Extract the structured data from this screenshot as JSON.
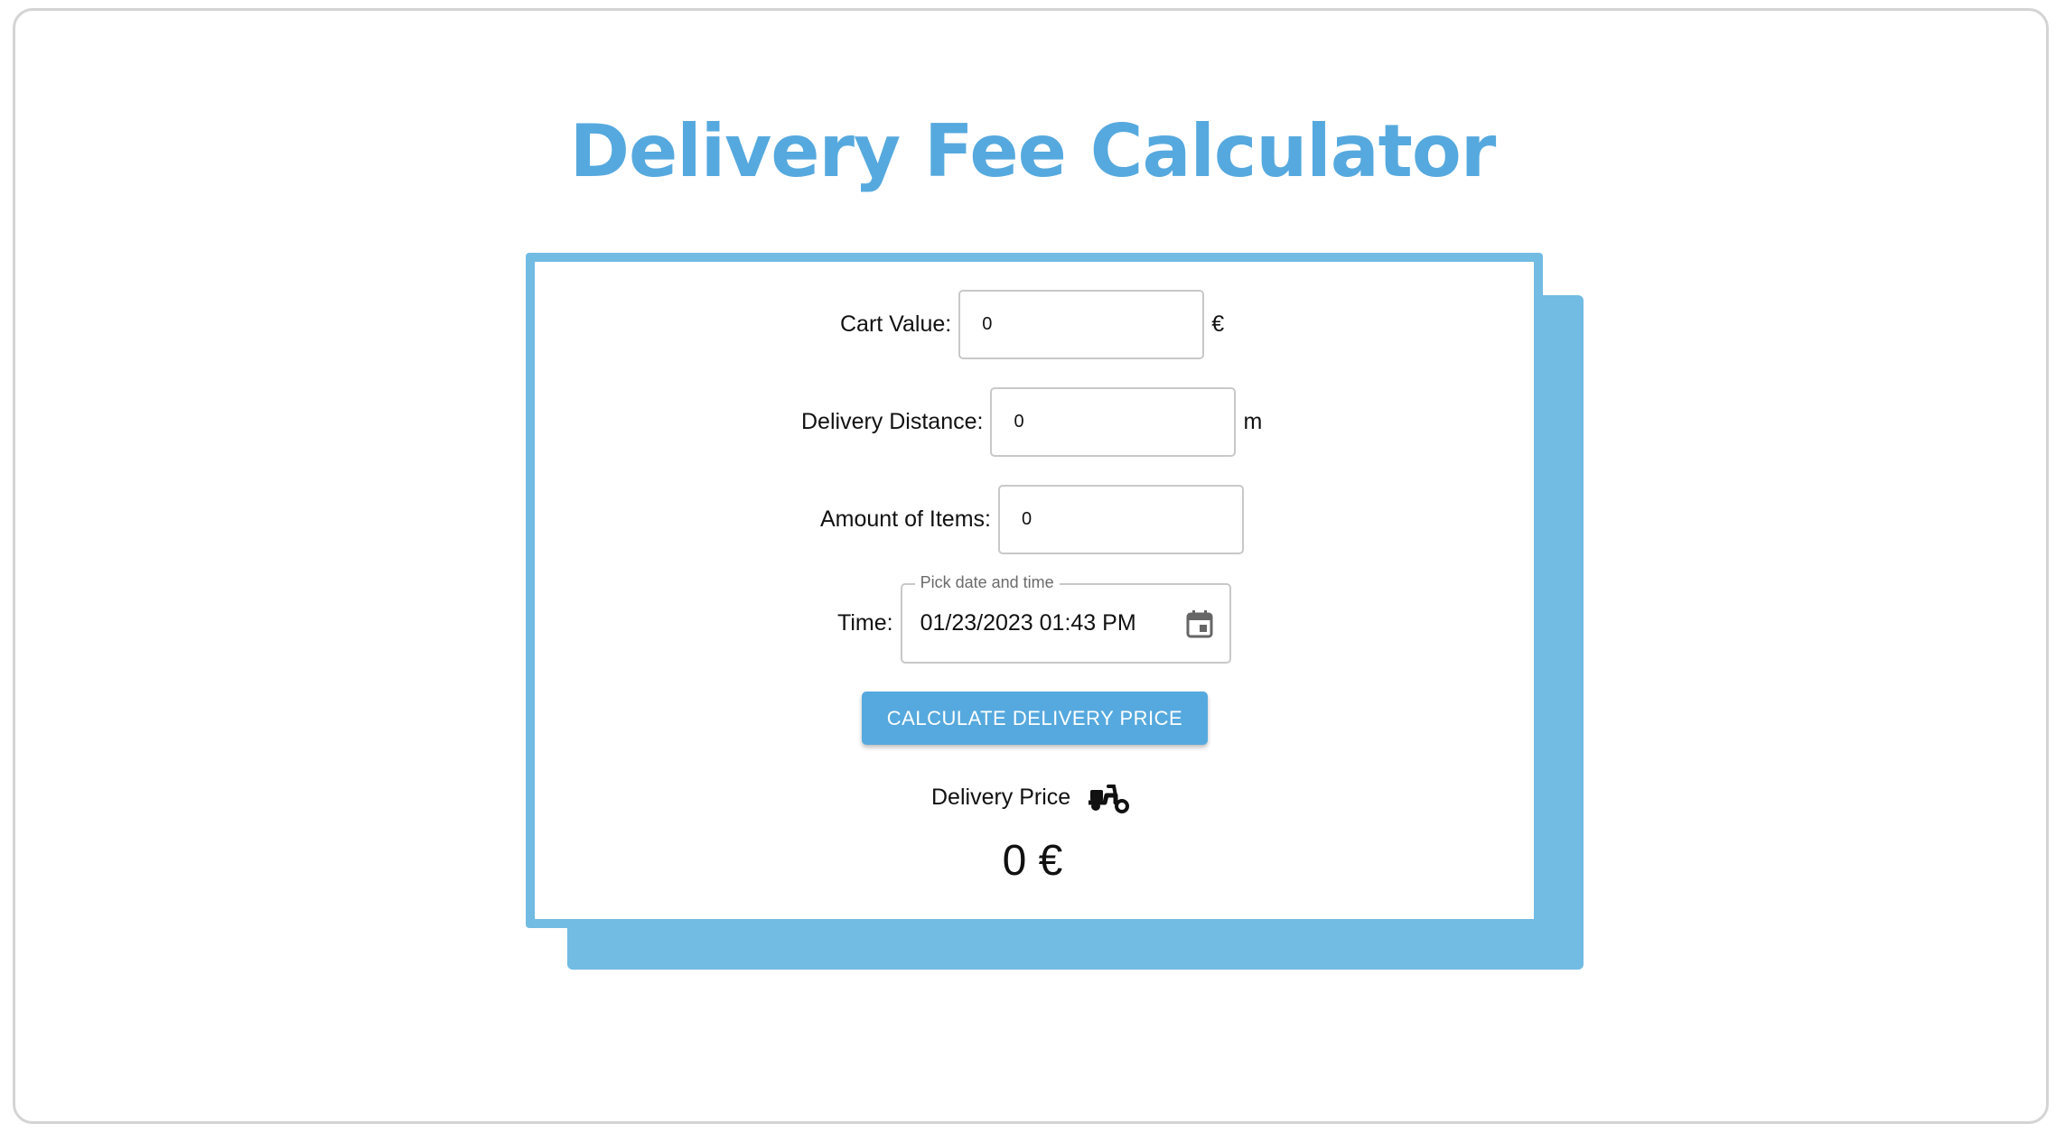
{
  "title": "Delivery Fee Calculator",
  "colors": {
    "accent": "#56a9de",
    "card_border": "#72bbe3",
    "text": "#111111"
  },
  "form": {
    "cart_value": {
      "label": "Cart Value:",
      "value": "0",
      "unit": "€"
    },
    "delivery_distance": {
      "label": "Delivery Distance:",
      "value": "0",
      "unit": "m"
    },
    "amount_of_items": {
      "label": "Amount of Items:",
      "value": "0"
    },
    "time": {
      "label": "Time:",
      "picker_label": "Pick date and time",
      "value": "01/23/2023 01:43 PM",
      "icon": "calendar-icon"
    },
    "calculate_button": "CALCULATE DELIVERY PRICE"
  },
  "result": {
    "label": "Delivery Price",
    "icon": "scooter-icon",
    "value": "0 €"
  }
}
